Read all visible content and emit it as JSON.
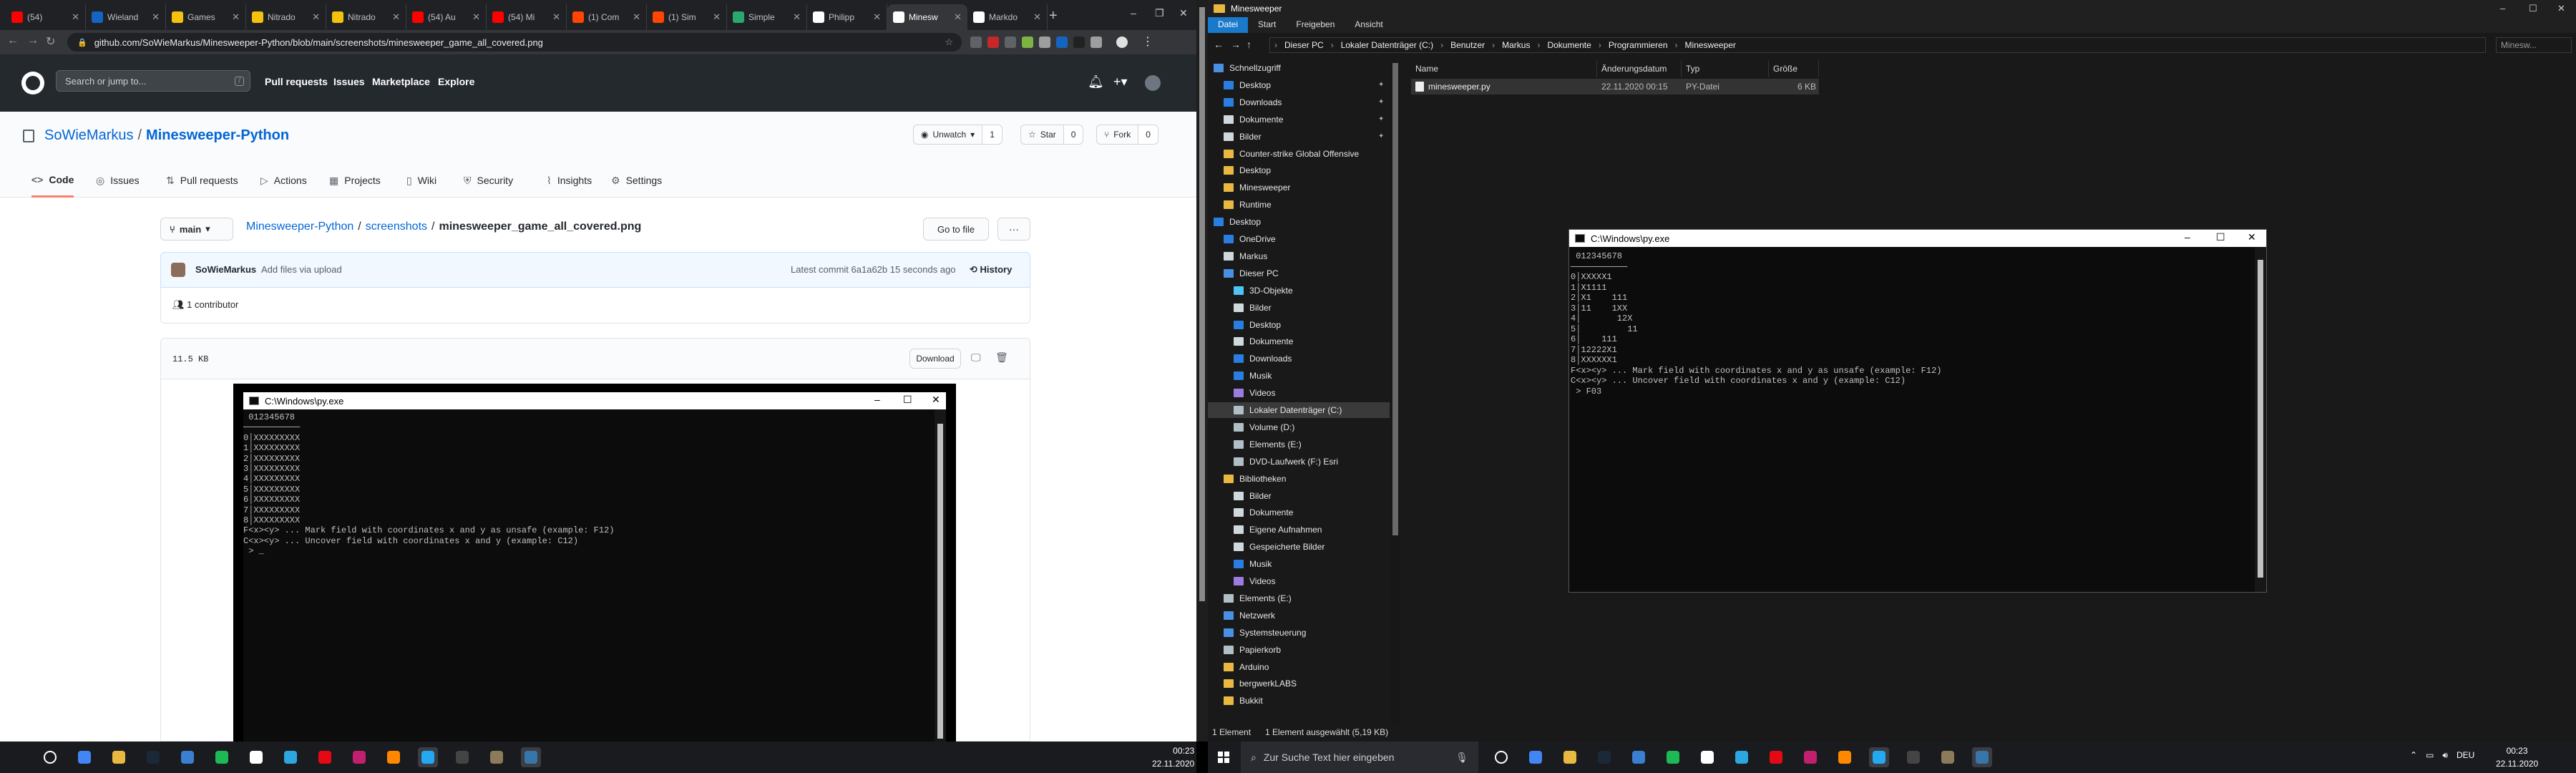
{
  "chrome": {
    "tabs": [
      {
        "label": "(54)",
        "color": "#ff0000"
      },
      {
        "label": "Wieland",
        "color": "#1565c0"
      },
      {
        "label": "Games",
        "color": "#f4c20d"
      },
      {
        "label": "Nitrado",
        "color": "#f4c20d"
      },
      {
        "label": "Nitrado",
        "color": "#f4c20d"
      },
      {
        "label": "(54) Au",
        "color": "#ff0000"
      },
      {
        "label": "(54) Mi",
        "color": "#ff0000"
      },
      {
        "label": "(1) Com",
        "color": "#ff4500"
      },
      {
        "label": "(1) Sim",
        "color": "#ff4500"
      },
      {
        "label": "Simple",
        "color": "#29a96e"
      },
      {
        "label": "Philipp",
        "color": "#ffffff"
      },
      {
        "label": "Minesw",
        "color": "#ffffff"
      },
      {
        "label": "Markdo",
        "color": "#ffffff"
      }
    ],
    "active_tab_index": 11,
    "url": "github.com/SoWieMarkus/Minesweeper-Python/blob/main/screenshots/minesweeper_game_all_covered.png"
  },
  "github": {
    "search_placeholder": "Search or jump to...",
    "slash_hint": "/",
    "nav": [
      "Pull requests",
      "Issues",
      "Marketplace",
      "Explore"
    ],
    "owner": "SoWieMarkus",
    "repo": "Minesweeper-Python",
    "unwatch": {
      "label": "Unwatch",
      "count": "1"
    },
    "star": {
      "label": "Star",
      "count": "0"
    },
    "fork": {
      "label": "Fork",
      "count": "0"
    },
    "tabs": [
      {
        "label": "Code",
        "icon": "<>"
      },
      {
        "label": "Issues",
        "icon": "◎"
      },
      {
        "label": "Pull requests",
        "icon": "⇅"
      },
      {
        "label": "Actions",
        "icon": "▷"
      },
      {
        "label": "Projects",
        "icon": "▦"
      },
      {
        "label": "Wiki",
        "icon": "▯"
      },
      {
        "label": "Security",
        "icon": "⛨"
      },
      {
        "label": "Insights",
        "icon": "⌇"
      },
      {
        "label": "Settings",
        "icon": "⚙"
      }
    ],
    "branch": "main",
    "breadcrumb": {
      "repo": "Minesweeper-Python",
      "folder": "screenshots",
      "file": "minesweeper_game_all_covered.png"
    },
    "go_to_file": "Go to file",
    "more": "···",
    "commit": {
      "author": "SoWieMarkus",
      "message": "Add files via upload",
      "latest": "Latest commit 6a1a62b 15 seconds ago",
      "history": "History"
    },
    "contributors": "1 contributor",
    "file_size": "11.5 KB",
    "download": "Download"
  },
  "shot_window": {
    "title": "C:\\Windows\\py.exe",
    "text": " 012345678\n───────────\n0│XXXXXXXXX\n1│XXXXXXXXX\n2│XXXXXXXXX\n3│XXXXXXXXX\n4│XXXXXXXXX\n5│XXXXXXXXX\n6│XXXXXXXXX\n7│XXXXXXXXX\n8│XXXXXXXXX\nF<x><y> ... Mark field with coordinates x and y as unsafe (example: F12)\nC<x><y> ... Uncover field with coordinates x and y (example: C12)\n > _"
  },
  "taskbar_left": {
    "icons": [
      {
        "name": "task-view-icon",
        "color": "#ffffff"
      },
      {
        "name": "chrome-icon",
        "color": "#4285f4"
      },
      {
        "name": "explorer-icon",
        "color": "#e8b840"
      },
      {
        "name": "steam-icon",
        "color": "#1b2838"
      },
      {
        "name": "ubisoft-icon",
        "color": "#3b7fd1"
      },
      {
        "name": "spotify-icon",
        "color": "#1db954"
      },
      {
        "name": "epic-icon",
        "color": "#ffffff"
      },
      {
        "name": "telegram-icon",
        "color": "#2ca5e0"
      },
      {
        "name": "netflix-icon",
        "color": "#e50914"
      },
      {
        "name": "jetbrains-icon",
        "color": "#c21f6e"
      },
      {
        "name": "vlc-icon",
        "color": "#ff8800"
      },
      {
        "name": "vscode-icon",
        "color": "#23a9f2"
      },
      {
        "name": "terminal-icon",
        "color": "#444444"
      },
      {
        "name": "gimp-icon",
        "color": "#8c7b5a"
      },
      {
        "name": "python-icon",
        "color": "#3776ab"
      }
    ],
    "time": "00:23",
    "date": "22.11.2020"
  },
  "explorer": {
    "title": "Minesweeper",
    "ribbon": [
      "Datei",
      "Start",
      "Freigeben",
      "Ansicht"
    ],
    "path": [
      "Dieser PC",
      "Lokaler Datenträger (C:)",
      "Benutzer",
      "Markus",
      "Dokumente",
      "Programmieren",
      "Minesweeper"
    ],
    "search_placeholder": "Minesw...",
    "nav_items": [
      {
        "label": "Schnellzugriff",
        "color": "#4a90e2",
        "indent": 0,
        "pin": false
      },
      {
        "label": "Desktop",
        "color": "#2a7de1",
        "indent": 1,
        "pin": true
      },
      {
        "label": "Downloads",
        "color": "#2a7de1",
        "indent": 1,
        "pin": true
      },
      {
        "label": "Dokumente",
        "color": "#cfd8dc",
        "indent": 1,
        "pin": true
      },
      {
        "label": "Bilder",
        "color": "#cfd8dc",
        "indent": 1,
        "pin": true
      },
      {
        "label": "Counter-strike  Global Offensive",
        "color": "#e8b840",
        "indent": 1,
        "pin": false
      },
      {
        "label": "Desktop",
        "color": "#e8b840",
        "indent": 1,
        "pin": false
      },
      {
        "label": "Minesweeper",
        "color": "#e8b840",
        "indent": 1,
        "pin": false
      },
      {
        "label": "Runtime",
        "color": "#e8b840",
        "indent": 1,
        "pin": false
      },
      {
        "label": "Desktop",
        "color": "#2a7de1",
        "indent": 0,
        "pin": false
      },
      {
        "label": "OneDrive",
        "color": "#2a7de1",
        "indent": 1,
        "pin": false
      },
      {
        "label": "Markus",
        "color": "#cfd8dc",
        "indent": 1,
        "pin": false
      },
      {
        "label": "Dieser PC",
        "color": "#4a90e2",
        "indent": 1,
        "pin": false
      },
      {
        "label": "3D-Objekte",
        "color": "#4fc3f7",
        "indent": 2,
        "pin": false
      },
      {
        "label": "Bilder",
        "color": "#cfd8dc",
        "indent": 2,
        "pin": false
      },
      {
        "label": "Desktop",
        "color": "#2a7de1",
        "indent": 2,
        "pin": false
      },
      {
        "label": "Dokumente",
        "color": "#cfd8dc",
        "indent": 2,
        "pin": false
      },
      {
        "label": "Downloads",
        "color": "#2a7de1",
        "indent": 2,
        "pin": false
      },
      {
        "label": "Musik",
        "color": "#2a7de1",
        "indent": 2,
        "pin": false
      },
      {
        "label": "Videos",
        "color": "#9c7ce0",
        "indent": 2,
        "pin": false
      },
      {
        "label": "Lokaler Datenträger (C:)",
        "color": "#b0bec5",
        "indent": 2,
        "pin": false
      },
      {
        "label": "Volume (D:)",
        "color": "#b0bec5",
        "indent": 2,
        "pin": false
      },
      {
        "label": "Elements (E:)",
        "color": "#b0bec5",
        "indent": 2,
        "pin": false
      },
      {
        "label": "DVD-Laufwerk (F:) Esri",
        "color": "#b0bec5",
        "indent": 2,
        "pin": false
      },
      {
        "label": "Bibliotheken",
        "color": "#e8b840",
        "indent": 1,
        "pin": false
      },
      {
        "label": "Bilder",
        "color": "#cfd8dc",
        "indent": 2,
        "pin": false
      },
      {
        "label": "Dokumente",
        "color": "#cfd8dc",
        "indent": 2,
        "pin": false
      },
      {
        "label": "Eigene Aufnahmen",
        "color": "#cfd8dc",
        "indent": 2,
        "pin": false
      },
      {
        "label": "Gespeicherte Bilder",
        "color": "#cfd8dc",
        "indent": 2,
        "pin": false
      },
      {
        "label": "Musik",
        "color": "#2a7de1",
        "indent": 2,
        "pin": false
      },
      {
        "label": "Videos",
        "color": "#9c7ce0",
        "indent": 2,
        "pin": false
      },
      {
        "label": "Elements (E:)",
        "color": "#b0bec5",
        "indent": 1,
        "pin": false
      },
      {
        "label": "Netzwerk",
        "color": "#4a90e2",
        "indent": 1,
        "pin": false
      },
      {
        "label": "Systemsteuerung",
        "color": "#4a90e2",
        "indent": 1,
        "pin": false
      },
      {
        "label": "Papierkorb",
        "color": "#b0bec5",
        "indent": 1,
        "pin": false
      },
      {
        "label": "Arduino",
        "color": "#e8b840",
        "indent": 1,
        "pin": false
      },
      {
        "label": "bergwerkLABS",
        "color": "#e8b840",
        "indent": 1,
        "pin": false
      },
      {
        "label": "Bukkit",
        "color": "#e8b840",
        "indent": 1,
        "pin": false
      }
    ],
    "selected_nav_index": 20,
    "columns": [
      "Name",
      "Änderungsdatum",
      "Typ",
      "Größe"
    ],
    "file": {
      "name": "minesweeper.py",
      "date": "22.11.2020 00:15",
      "type": "PY-Datei",
      "size": "6 KB"
    },
    "status": {
      "count": "1 Element",
      "selected": "1 Element ausgewählt (5,19 KB)"
    }
  },
  "term_window": {
    "title": "C:\\Windows\\py.exe",
    "text": " 012345678\n───────────\n0│XXXXX1\n1│X1111\n2│X1    111\n3│11    1XX\n4│       12X\n5│         11\n6│    111\n7│12222X1\n8│XXXXXX1\nF<x><y> ... Mark field with coordinates x and y as unsafe (example: F12)\nC<x><y> ... Uncover field with coordinates x and y (example: C12)\n > F03"
  },
  "taskbar_right": {
    "search_placeholder": "Zur Suche Text hier eingeben",
    "icons": [
      {
        "name": "task-view-icon",
        "color": "#ffffff"
      },
      {
        "name": "chrome-icon",
        "color": "#4285f4"
      },
      {
        "name": "explorer-icon",
        "color": "#e8b840"
      },
      {
        "name": "steam-icon",
        "color": "#1b2838"
      },
      {
        "name": "ubisoft-icon",
        "color": "#3b7fd1"
      },
      {
        "name": "spotify-icon",
        "color": "#1db954"
      },
      {
        "name": "epic-icon",
        "color": "#ffffff"
      },
      {
        "name": "telegram-icon",
        "color": "#2ca5e0"
      },
      {
        "name": "netflix-icon",
        "color": "#e50914"
      },
      {
        "name": "jetbrains-icon",
        "color": "#c21f6e"
      },
      {
        "name": "vlc-icon",
        "color": "#ff8800"
      },
      {
        "name": "vscode-icon",
        "color": "#23a9f2"
      },
      {
        "name": "terminal-icon",
        "color": "#444444"
      },
      {
        "name": "gimp-icon",
        "color": "#8c7b5a"
      },
      {
        "name": "python-icon",
        "color": "#3776ab"
      }
    ],
    "lang": "DEU",
    "time": "00:23",
    "date": "22.11.2020"
  }
}
